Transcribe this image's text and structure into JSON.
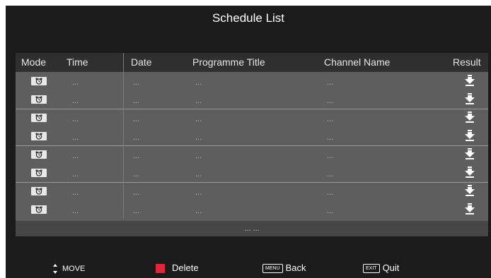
{
  "title": "Schedule List",
  "columns": {
    "mode": "Mode",
    "time": "Time",
    "date": "Date",
    "programme_title": "Programme Title",
    "channel_name": "Channel Name",
    "result": "Result"
  },
  "rows": [
    {
      "time": "...",
      "date": "...",
      "title": "...",
      "channel": "..."
    },
    {
      "time": "...",
      "date": "...",
      "title": "...",
      "channel": "..."
    },
    {
      "time": "...",
      "date": "...",
      "title": "...",
      "channel": "..."
    },
    {
      "time": "...",
      "date": "...",
      "title": "...",
      "channel": "..."
    },
    {
      "time": "...",
      "date": "...",
      "title": "...",
      "channel": "..."
    },
    {
      "time": "...",
      "date": "...",
      "title": "...",
      "channel": "..."
    },
    {
      "time": "...",
      "date": "...",
      "title": "...",
      "channel": "..."
    },
    {
      "time": "...",
      "date": "...",
      "title": "...",
      "channel": "..."
    }
  ],
  "page_indicator": "... ...",
  "legend": {
    "move": "MOVE",
    "delete": "Delete",
    "back_key": "MENU",
    "back": "Back",
    "quit_key": "EXIT",
    "quit": "Quit"
  },
  "colors": {
    "delete_key": "#e3253b"
  },
  "icons": {
    "mode": "alarm-clock-icon",
    "result": "download-arrow-icon",
    "move": "up-down-arrows-icon"
  }
}
